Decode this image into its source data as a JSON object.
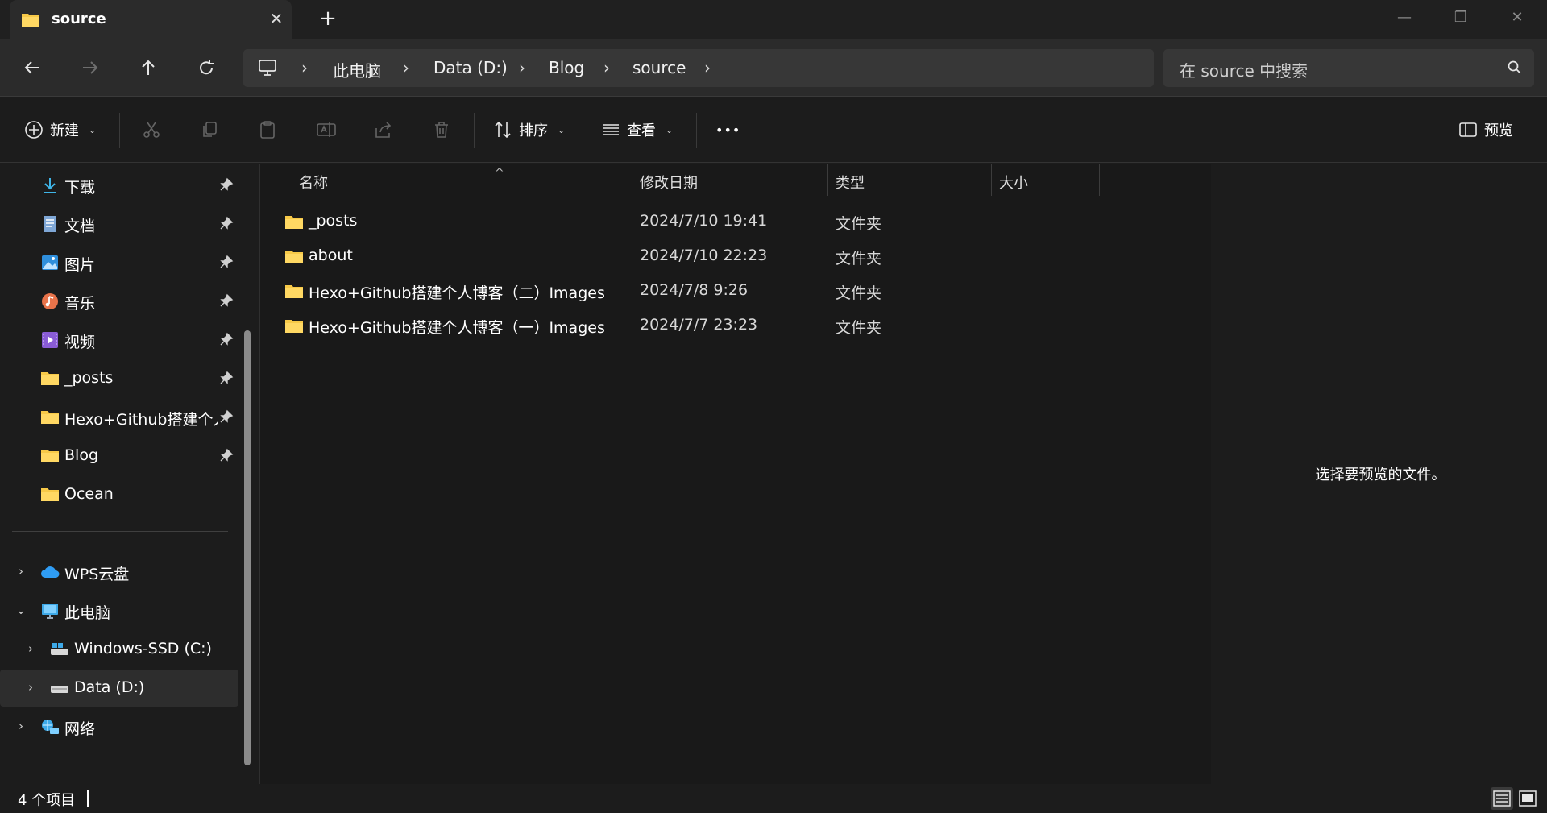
{
  "window": {
    "tab_title": "source",
    "tab_close": "✕",
    "new_tab": "+",
    "minimize": "—",
    "restore": "❐",
    "close": "✕"
  },
  "address": {
    "crumbs": [
      "此电脑",
      "Data (D:)",
      "Blog",
      "source"
    ],
    "search_placeholder": "在 source 中搜索"
  },
  "toolbar": {
    "new_label": "新建",
    "sort_label": "排序",
    "view_label": "查看",
    "more_label": "•••",
    "preview_label": "预览"
  },
  "sidebar": {
    "quick_access": [
      {
        "label": "下载",
        "icon": "download-icon",
        "pinned": true
      },
      {
        "label": "文档",
        "icon": "document-icon",
        "pinned": true
      },
      {
        "label": "图片",
        "icon": "pictures-icon",
        "pinned": true
      },
      {
        "label": "音乐",
        "icon": "music-icon",
        "pinned": true
      },
      {
        "label": "视频",
        "icon": "video-icon",
        "pinned": true
      },
      {
        "label": "_posts",
        "icon": "folder-icon",
        "pinned": true
      },
      {
        "label": "Hexo+Github搭建个人博客（一）Images",
        "icon": "folder-icon",
        "pinned": true
      },
      {
        "label": "Blog",
        "icon": "folder-icon",
        "pinned": true
      },
      {
        "label": "Ocean",
        "icon": "folder-icon",
        "pinned": false
      }
    ],
    "tree": [
      {
        "label": "WPS云盘",
        "icon": "cloud-icon",
        "expanded": false
      },
      {
        "label": "此电脑",
        "icon": "computer-icon",
        "expanded": true
      },
      {
        "label": "Windows-SSD (C:)",
        "icon": "drive-c-icon",
        "expanded": false
      },
      {
        "label": "Data (D:)",
        "icon": "drive-d-icon",
        "expanded": false,
        "selected": true
      },
      {
        "label": "网络",
        "icon": "network-icon",
        "expanded": false
      }
    ]
  },
  "columns": {
    "name": "名称",
    "modified": "修改日期",
    "type": "类型",
    "size": "大小",
    "sort_indicator": "^"
  },
  "files": [
    {
      "name": "_posts",
      "modified": "2024/7/10 19:41",
      "type": "文件夹"
    },
    {
      "name": "about",
      "modified": "2024/7/10 22:23",
      "type": "文件夹"
    },
    {
      "name": "Hexo+Github搭建个人博客（二）Images",
      "modified": "2024/7/8 9:26",
      "type": "文件夹"
    },
    {
      "name": "Hexo+Github搭建个人博客（一）Images",
      "modified": "2024/7/7 23:23",
      "type": "文件夹"
    }
  ],
  "preview": {
    "message": "选择要预览的文件。"
  },
  "status": {
    "item_count": "4 个项目"
  },
  "colors": {
    "folder": "#f7c948",
    "background": "#1c1c1c",
    "selected": "#2d2d2d"
  }
}
